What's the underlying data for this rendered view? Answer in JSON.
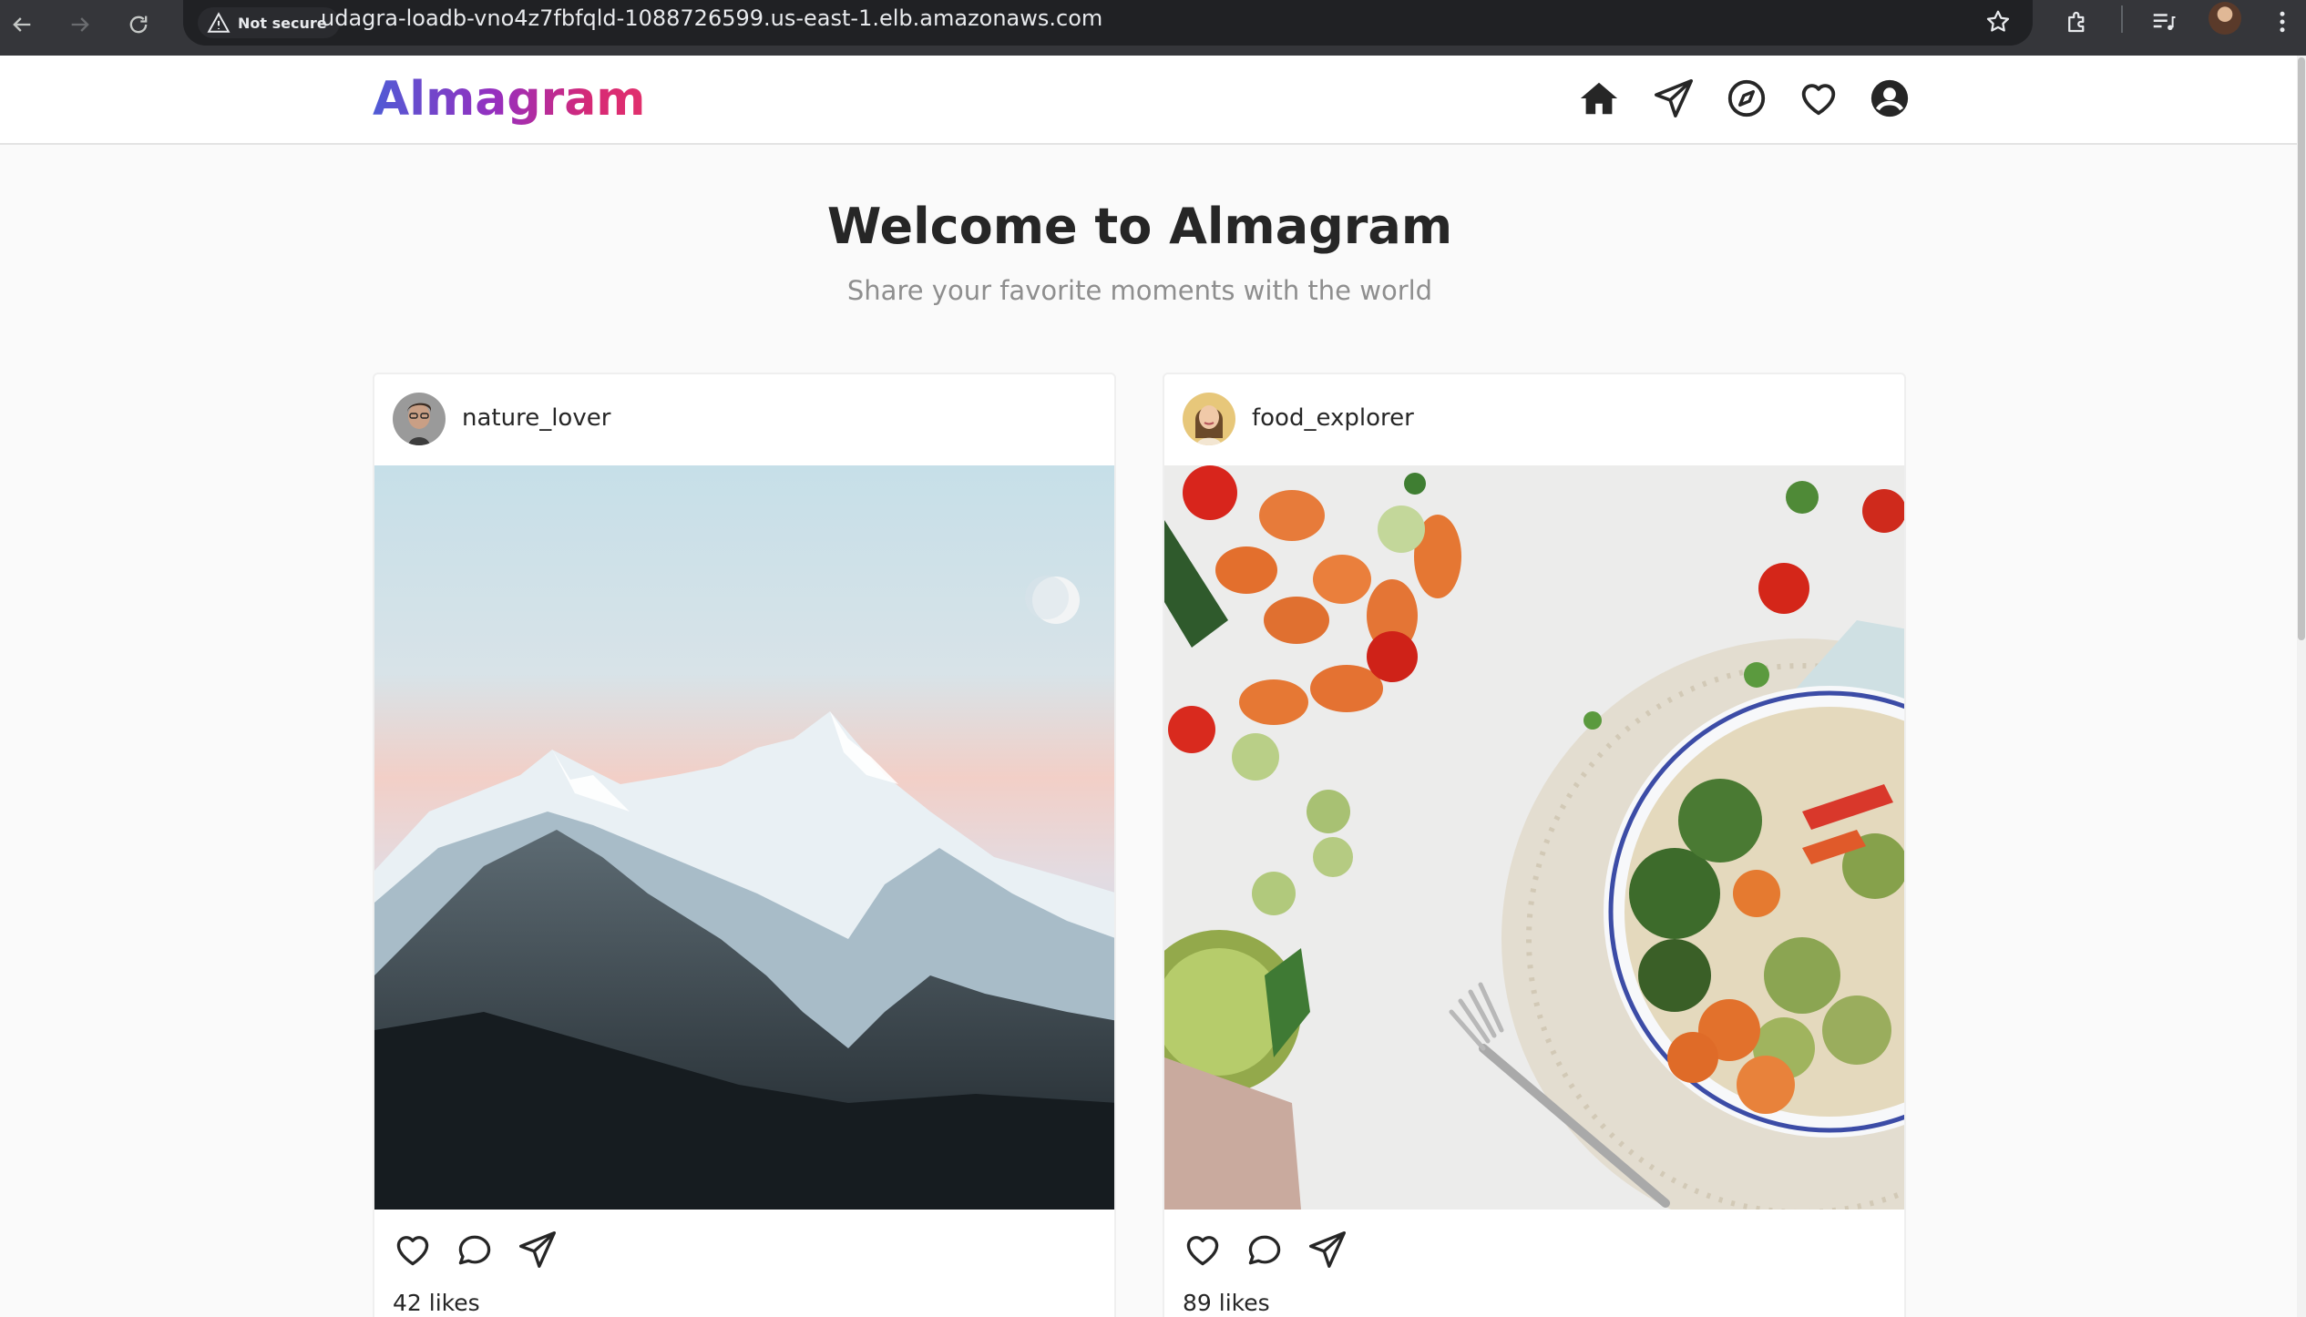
{
  "browser": {
    "security_label": "Not secure",
    "url": "udagra-loadb-vno4z7fbfqld-1088726599.us-east-1.elb.amazonaws.com"
  },
  "header": {
    "logo": "Almagram",
    "nav_icons": [
      "home-icon",
      "paper-plane-icon",
      "compass-icon",
      "heart-icon",
      "user-circle-icon"
    ]
  },
  "hero": {
    "title": "Welcome to Almagram",
    "subtitle": "Share your favorite moments with the world"
  },
  "posts": [
    {
      "username": "nature_lover",
      "likes": "42 likes",
      "image": "snowy-mountain-photo"
    },
    {
      "username": "food_explorer",
      "likes": "89 likes",
      "image": "vegetable-bowl-photo"
    }
  ],
  "colors": {
    "brand_gradient": [
      "#4f5bd5",
      "#962fbf",
      "#d62976"
    ],
    "text": "#262626",
    "muted": "#8e8e8e"
  }
}
